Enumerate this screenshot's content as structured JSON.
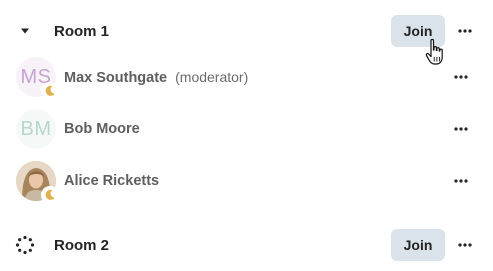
{
  "rooms": [
    {
      "title": "Room 1",
      "join_label": "Join",
      "participants": [
        {
          "initials": "MS",
          "name": "Max Southgate",
          "role": "(moderator)",
          "avatar_color": "#c7a3cf",
          "avatar_bg": "#f7f1f8",
          "status_icon": "moon-icon"
        },
        {
          "initials": "BM",
          "name": "Bob Moore",
          "role": "",
          "avatar_color": "#b9d6cc",
          "avatar_bg": "#f4f9f7",
          "status_icon": ""
        },
        {
          "initials": "",
          "name": "Alice Ricketts",
          "role": "",
          "avatar_color": "",
          "avatar_bg": "#d9c2a6",
          "status_icon": "moon-icon"
        }
      ]
    },
    {
      "title": "Room 2",
      "join_label": "Join",
      "participants": []
    }
  ],
  "colors": {
    "join_bg": "#dbe3ea",
    "presence_away": "#e3b04b",
    "text_primary": "#242424",
    "text_secondary": "#5e5e5e"
  }
}
